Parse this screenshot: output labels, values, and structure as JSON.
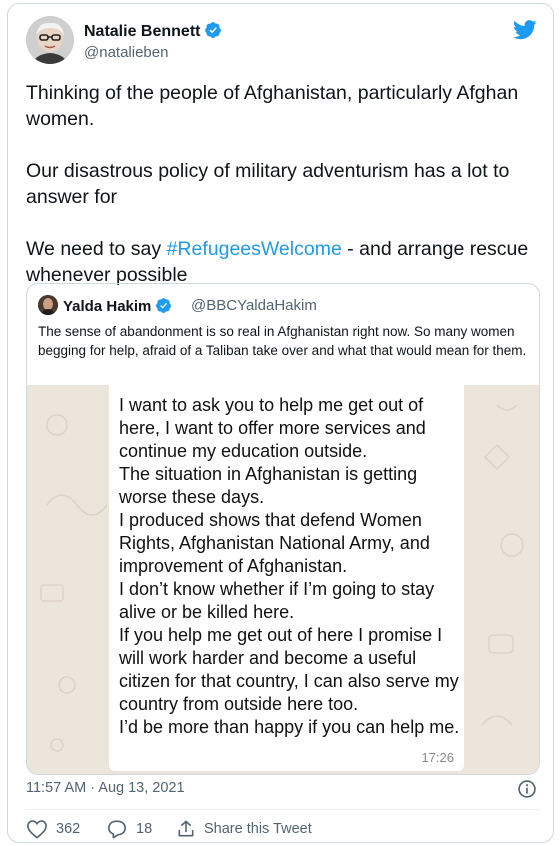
{
  "tweet": {
    "author": {
      "name": "Natalie Bennett",
      "handle": "@natalieben"
    },
    "paragraphs": [
      {
        "before": "Thinking of the people of Afghanistan, particularly Afghan women.",
        "hashtag": "",
        "after": ""
      },
      {
        "before": "Our disastrous policy of military adventurism has a lot to answer for",
        "hashtag": "",
        "after": ""
      },
      {
        "before": "We need to say ",
        "hashtag": "#RefugeesWelcome",
        "after": " - and arrange rescue whenever possible"
      }
    ],
    "timestamp": "11:57 AM · Aug 13, 2021",
    "likes": "362",
    "replies": "18",
    "share_label": "Share this Tweet"
  },
  "quote": {
    "author": {
      "name": "Yalda Hakim",
      "handle": "@BBCYaldaHakim"
    },
    "text": "The sense of abandonment is so real in Afghanistan right now. So many women begging for help, afraid of a Taliban take over and what that would mean for them.",
    "image": {
      "lines": [
        "I want to ask you to help me get out of here, I want to offer more services and continue my education outside.",
        "The situation in Afghanistan is getting worse these days.",
        "I produced shows that defend Women Rights, Afghanistan National Army, and improvement of Afghanistan.",
        "I don’t know whether if I’m going to stay alive or be killed here.",
        "If you help me get out of here I promise I will work harder and become a useful citizen for that country, I can also serve my country from outside here too.",
        "I’d be more than happy if you can help me."
      ],
      "time": "17:26"
    }
  },
  "colors": {
    "accent": "#1d9bf0",
    "secondary_text": "#536471",
    "border": "#cfd9de",
    "chat_background": "#ece5db"
  },
  "icons": {
    "brand": "twitter-bird-icon",
    "verified": "verified-badge-icon",
    "info": "info-icon",
    "like": "heart-icon",
    "reply": "reply-bubble-icon",
    "share": "share-icon"
  }
}
